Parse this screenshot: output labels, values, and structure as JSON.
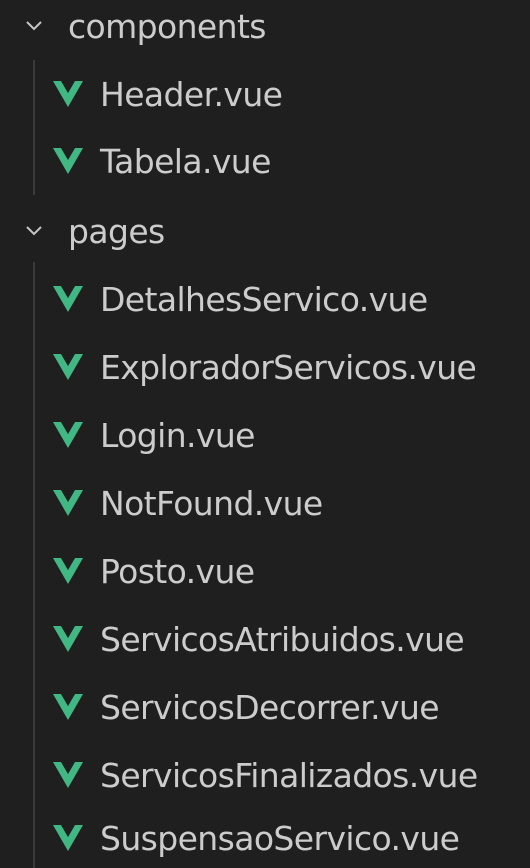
{
  "explorer": {
    "folders": [
      {
        "name": "components",
        "expanded": true,
        "files": [
          {
            "name": "Header.vue",
            "icon": "vue-icon"
          },
          {
            "name": "Tabela.vue",
            "icon": "vue-icon"
          }
        ]
      },
      {
        "name": "pages",
        "expanded": true,
        "files": [
          {
            "name": "DetalhesServico.vue",
            "icon": "vue-icon"
          },
          {
            "name": "ExploradorServicos.vue",
            "icon": "vue-icon"
          },
          {
            "name": "Login.vue",
            "icon": "vue-icon"
          },
          {
            "name": "NotFound.vue",
            "icon": "vue-icon"
          },
          {
            "name": "Posto.vue",
            "icon": "vue-icon"
          },
          {
            "name": "ServicosAtribuidos.vue",
            "icon": "vue-icon"
          },
          {
            "name": "ServicosDecorrer.vue",
            "icon": "vue-icon"
          },
          {
            "name": "ServicosFinalizados.vue",
            "icon": "vue-icon"
          },
          {
            "name": "SuspensaoServico.vue",
            "icon": "vue-icon"
          }
        ]
      }
    ]
  },
  "colors": {
    "background": "#1f1f1f",
    "text": "#cccccc",
    "vue_green": "#41b883",
    "chevron": "#c5c5c5",
    "indent_guide": "#3a3a3a"
  }
}
